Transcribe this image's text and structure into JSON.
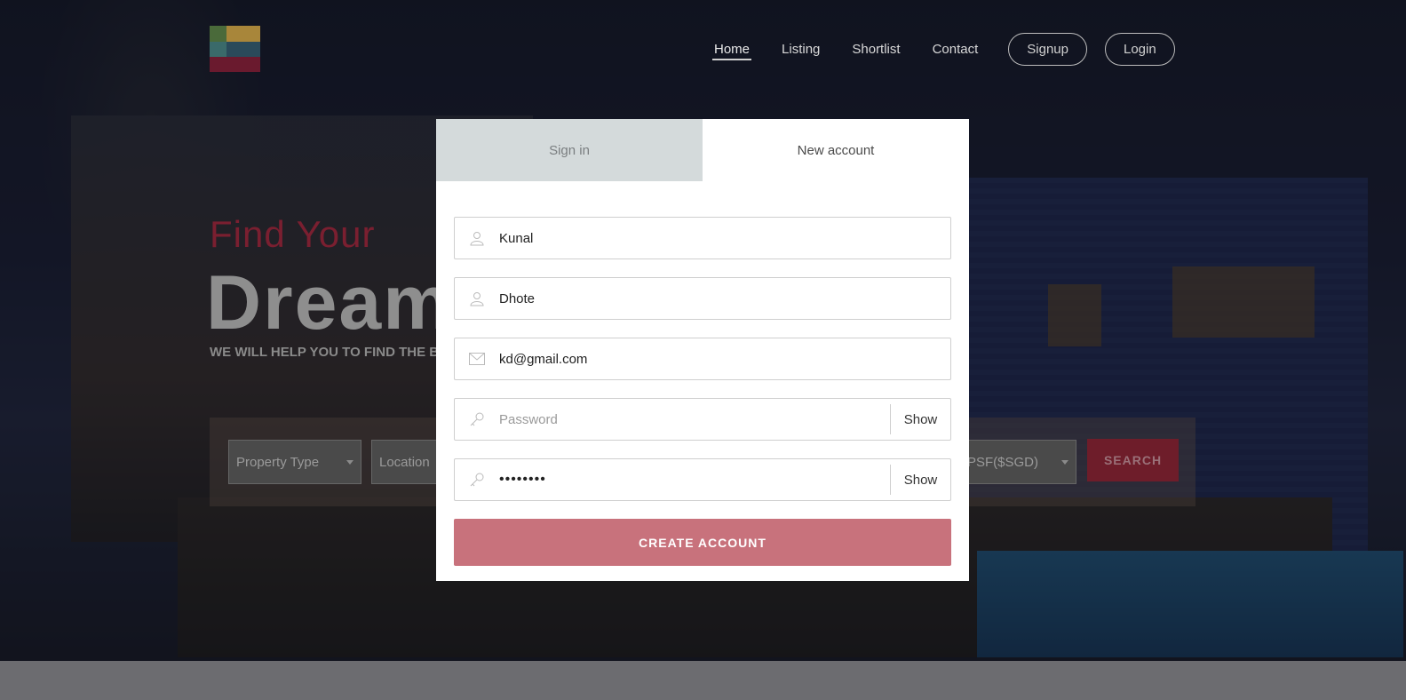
{
  "nav": {
    "items": [
      {
        "label": "Home",
        "active": true
      },
      {
        "label": "Listing"
      },
      {
        "label": "Shortlist"
      },
      {
        "label": "Contact"
      }
    ],
    "signup_label": "Signup",
    "login_label": "Login"
  },
  "hero": {
    "kicker": "Find Your",
    "title": "Dream",
    "subtitle": "WE WILL HELP YOU TO FIND THE BE"
  },
  "search": {
    "property_type": "Property Type",
    "location": "Location",
    "psf": "PSF($SGD)",
    "button_label": "SEARCH"
  },
  "modal": {
    "tabs": [
      {
        "label": "Sign in",
        "active": false
      },
      {
        "label": "New account",
        "active": true
      }
    ],
    "fields": {
      "first_name": {
        "value": "Kunal",
        "icon": "user-icon"
      },
      "last_name": {
        "value": "Dhote",
        "icon": "user-icon"
      },
      "email": {
        "value": "kd@gmail.com",
        "icon": "envelope-icon"
      },
      "password": {
        "value": "",
        "placeholder": "Password",
        "show_label": "Show",
        "icon": "key-icon"
      },
      "confirm_password": {
        "value": "••••••••",
        "show_label": "Show",
        "icon": "key-icon"
      }
    },
    "create_label": "CREATE ACCOUNT"
  },
  "colors": {
    "accent": "#c8727c",
    "tab_inactive": "#d4dadb",
    "brand_red": "#7a1f30"
  }
}
